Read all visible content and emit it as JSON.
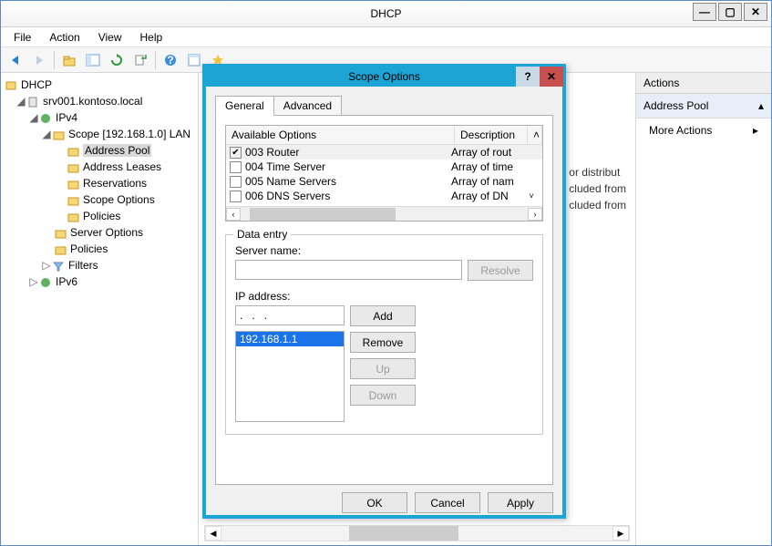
{
  "window": {
    "title": "DHCP"
  },
  "menubar": [
    "File",
    "Action",
    "View",
    "Help"
  ],
  "tree": {
    "root": "DHCP",
    "server": "srv001.kontoso.local",
    "ipv4": "IPv4",
    "scope": "Scope [192.168.1.0] LAN",
    "address_pool": "Address Pool",
    "address_leases": "Address Leases",
    "reservations": "Reservations",
    "scope_options": "Scope Options",
    "policies": "Policies",
    "server_options": "Server Options",
    "server_policies": "Policies",
    "filters": "Filters",
    "ipv6": "IPv6"
  },
  "bg": {
    "line1": "or distribut",
    "line2": "cluded from",
    "line3": "cluded from"
  },
  "actions": {
    "header": "Actions",
    "sub": "Address Pool",
    "more": "More Actions"
  },
  "dialog": {
    "title": "Scope Options",
    "tabs": {
      "general": "General",
      "advanced": "Advanced"
    },
    "lv_head": {
      "c1": "Available Options",
      "c2": "Description"
    },
    "rows": [
      {
        "checked": true,
        "name": "003 Router",
        "desc": "Array of rout"
      },
      {
        "checked": false,
        "name": "004 Time Server",
        "desc": "Array of time"
      },
      {
        "checked": false,
        "name": "005 Name Servers",
        "desc": "Array of nam"
      },
      {
        "checked": false,
        "name": "006 DNS Servers",
        "desc": "Array of DN"
      }
    ],
    "data_entry": {
      "legend": "Data entry",
      "server_name_lbl": "Server name:",
      "resolve": "Resolve",
      "ip_lbl": "IP address:",
      "ip_value": ".   .   .",
      "add": "Add",
      "remove": "Remove",
      "up": "Up",
      "down": "Down",
      "list": [
        "192.168.1.1"
      ]
    },
    "buttons": {
      "ok": "OK",
      "cancel": "Cancel",
      "apply": "Apply"
    }
  }
}
